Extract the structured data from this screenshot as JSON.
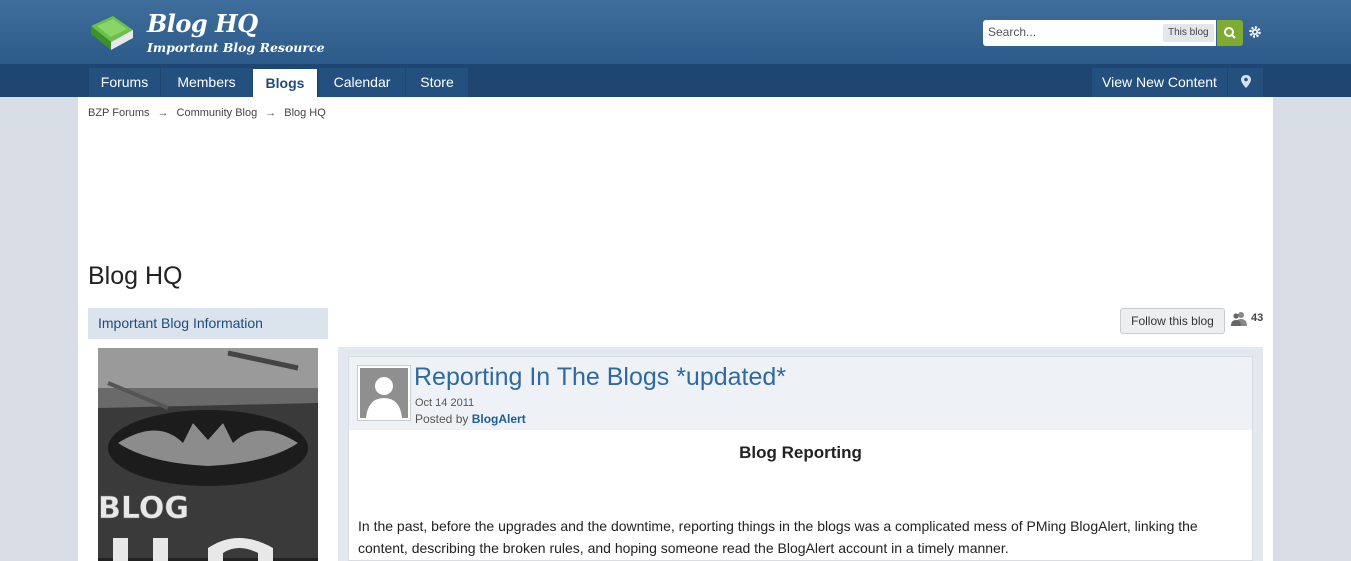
{
  "header": {
    "site_title": "Blog HQ",
    "site_subtitle": "Important Blog Resource",
    "logo_icon": "green-book-icon"
  },
  "search": {
    "placeholder": "Search...",
    "scope_label": "This blog",
    "button_icon": "search-icon",
    "settings_icon": "gear-icon"
  },
  "nav": {
    "tabs": [
      {
        "label": "Forums"
      },
      {
        "label": "Members"
      },
      {
        "label": "Blogs"
      },
      {
        "label": "Calendar"
      },
      {
        "label": "Store"
      }
    ],
    "active_tab": "Blogs",
    "view_new_content": "View New Content",
    "pin_icon": "map-pin-icon"
  },
  "breadcrumb": {
    "items": [
      "BZP Forums",
      "Community Blog",
      "Blog HQ"
    ],
    "separator": "→"
  },
  "page": {
    "title": "Blog HQ"
  },
  "sidebar": {
    "heading": "Important Blog Information"
  },
  "follow": {
    "button_label": "Follow this blog",
    "count": "43"
  },
  "entry": {
    "title": "Reporting In The Blogs *updated*",
    "date": "Oct 14 2011",
    "posted_by_label": "Posted by",
    "author": "BlogAlert",
    "heading": "Blog Reporting",
    "body": "In the past, before the upgrades and the downtime, reporting things in the blogs was a complicated mess of PMing BlogAlert, linking the content, describing the broken rules, and hoping someone read the BlogAlert account in a timely manner."
  },
  "colors": {
    "header_blue": "#2c5a89",
    "nav_blue": "#1f4571",
    "link_blue": "#2e6aa0",
    "search_green": "#7fab33"
  }
}
